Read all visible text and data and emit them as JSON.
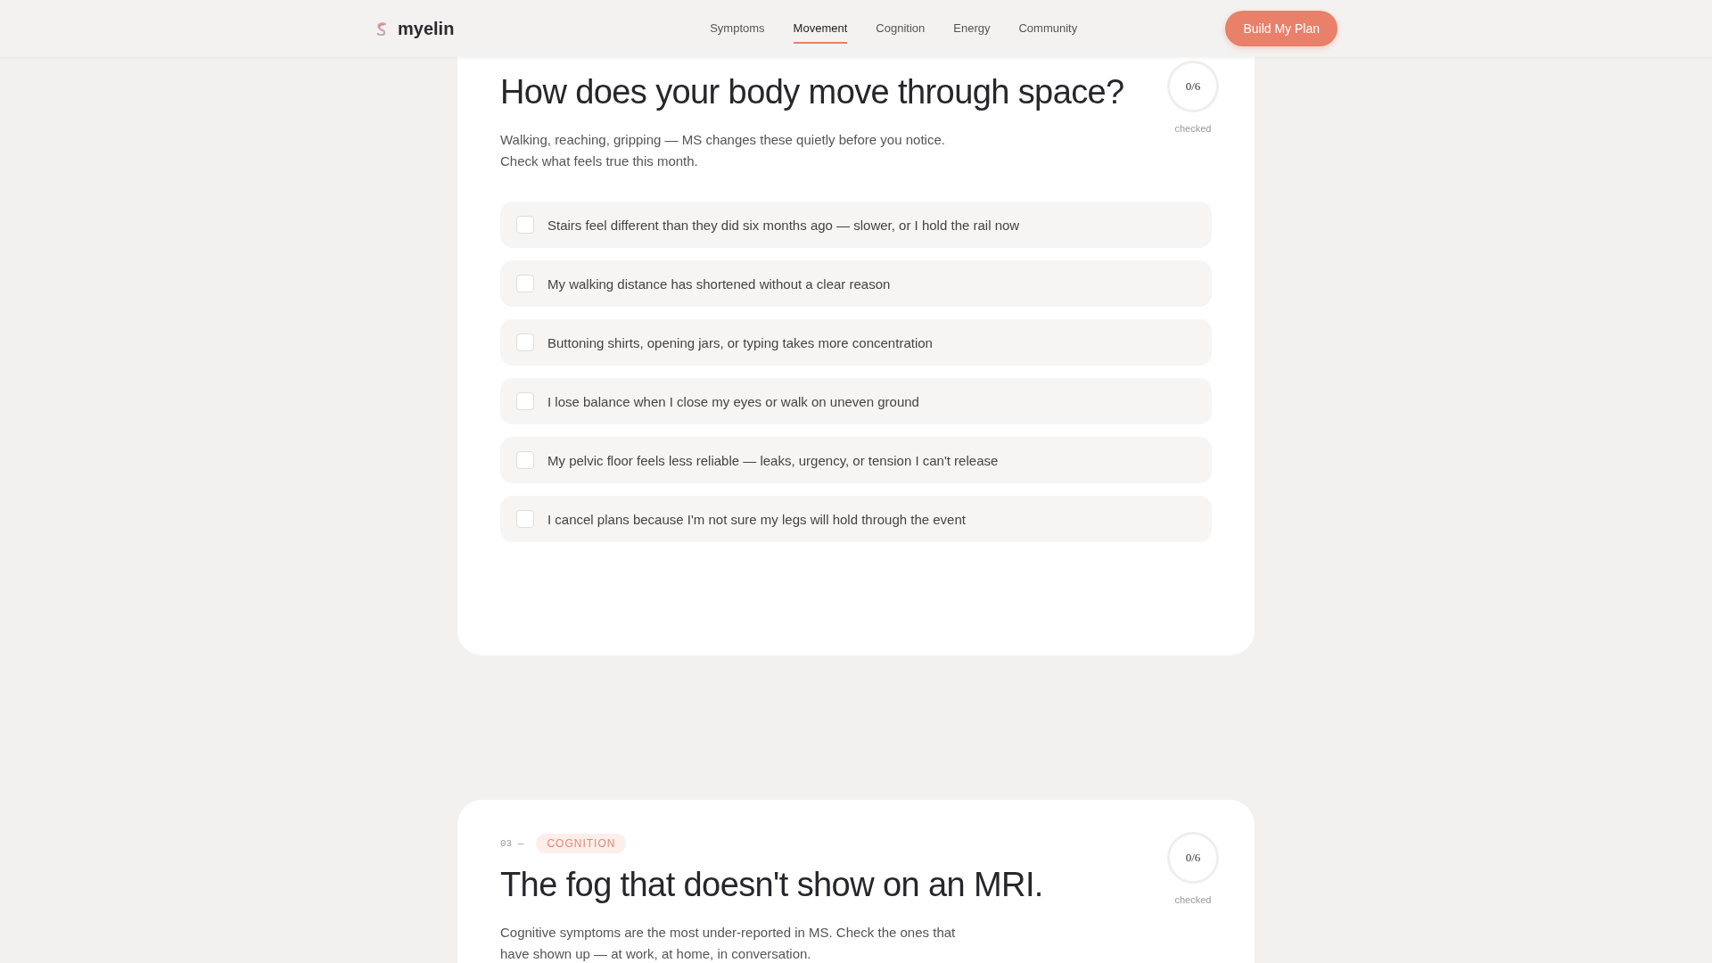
{
  "header": {
    "brand": "myelin",
    "nav": [
      {
        "label": "Symptoms",
        "selected": false
      },
      {
        "label": "Movement",
        "selected": true
      },
      {
        "label": "Cognition",
        "selected": false
      },
      {
        "label": "Energy",
        "selected": false
      },
      {
        "label": "Community",
        "selected": false
      }
    ],
    "cta": "Build My Plan"
  },
  "sections": [
    {
      "title": "How does your body move through space?",
      "description": [
        "Walking, reaching, gripping — MS changes these quietly before you notice.",
        "Check what feels true this month."
      ],
      "progress": "0/6",
      "progress_label": "checked",
      "items": [
        {
          "label": "Stairs feel different than they did six months ago — slower, or I hold the rail now",
          "checked": false
        },
        {
          "label": "My walking distance has shortened without a clear reason",
          "checked": false
        },
        {
          "label": "Buttoning shirts, opening jars, or typing takes more concentration",
          "checked": false
        },
        {
          "label": "I lose balance when I close my eyes or walk on uneven ground",
          "checked": false
        },
        {
          "label": "My pelvic floor feels less reliable — leaks, urgency, or tension I can't release",
          "checked": false
        },
        {
          "label": "I cancel plans because I'm not sure my legs will hold through the event",
          "checked": false
        }
      ]
    },
    {
      "number": "03 —",
      "tag": "COGNITION",
      "title": "The fog that doesn't show on an MRI.",
      "description": [
        "Cognitive symptoms are the most under-reported in MS. Check the ones that",
        "have shown up — at work, at home, in conversation."
      ],
      "progress": "0/6",
      "progress_label": "checked"
    }
  ]
}
